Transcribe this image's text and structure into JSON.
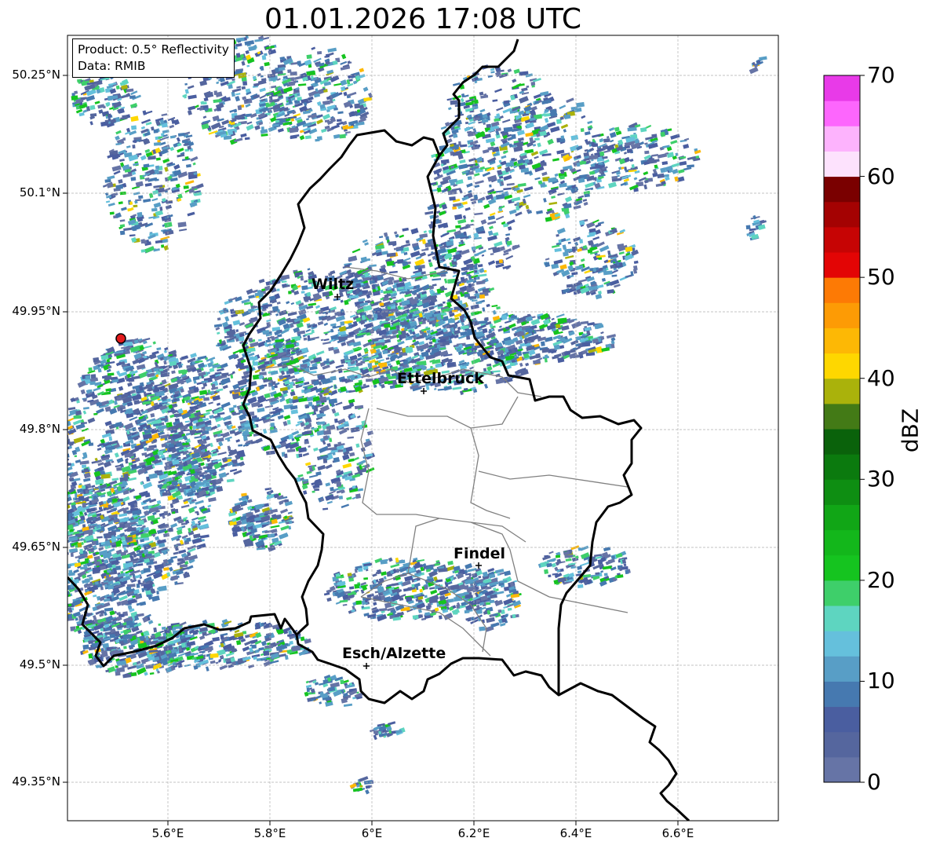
{
  "title": "01.01.2026 17:08 UTC",
  "info_box": {
    "product": "Product: 0.5° Reflectivity",
    "data_source": "Data: RMIB"
  },
  "axes": {
    "lat_ticks": [
      "50.25°N",
      "50.1°N",
      "49.95°N",
      "49.8°N",
      "49.65°N",
      "49.5°N",
      "49.35°N"
    ],
    "lon_ticks": [
      "5.6°E",
      "5.8°E",
      "6°E",
      "6.2°E",
      "6.4°E",
      "6.6°E"
    ]
  },
  "cities": [
    {
      "name": "Wiltz"
    },
    {
      "name": "Ettelbruck"
    },
    {
      "name": "Findel"
    },
    {
      "name": "Esch/Alzette"
    }
  ],
  "radar_site": {
    "color": "#e31a1c"
  },
  "colorbar": {
    "label": "dBZ",
    "min": 0,
    "max": 70,
    "tick_labels": [
      "70",
      "60",
      "50",
      "40",
      "30",
      "20",
      "10",
      "0"
    ],
    "colors": [
      "#6674a6",
      "#55669e",
      "#4a5ea0",
      "#4679b0",
      "#589ec6",
      "#65c0dc",
      "#5ed5c0",
      "#3ecf6a",
      "#15c41f",
      "#13b71b",
      "#11a616",
      "#0e8e12",
      "#0b7a0e",
      "#0a620b",
      "#437a16",
      "#aab20b",
      "#fed700",
      "#fdb805",
      "#fd9b05",
      "#fd7a05",
      "#e30505",
      "#c60404",
      "#a40202",
      "#7a0000",
      "#fde2fd",
      "#fdb3fd",
      "#fd66fd",
      "#e83ae8"
    ]
  }
}
